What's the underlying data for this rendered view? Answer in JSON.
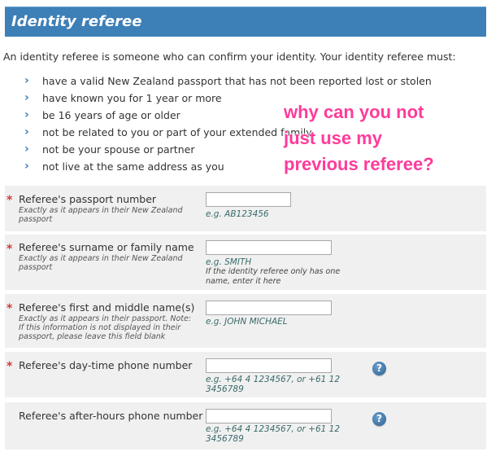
{
  "header": {
    "title": "Identity referee"
  },
  "intro": "An identity referee is someone who can confirm your identity. Your identity referee must:",
  "requirements": [
    "have a valid New Zealand passport that has not been reported lost or stolen",
    "have known you for 1 year or more",
    "be 16 years of age or older",
    "not be related to you or part of your extended family",
    "not be your spouse or partner",
    "not live at the same address as you"
  ],
  "annotation": {
    "line1": "why can you not",
    "line2": "just use my",
    "line3": "previous referee?"
  },
  "fields": {
    "passport": {
      "required": "*",
      "label": "Referee's passport number",
      "help": "Exactly as it appears in their New Zealand passport",
      "example": "e.g. AB123456",
      "value": ""
    },
    "surname": {
      "required": "*",
      "label": "Referee's surname or family name",
      "help": "Exactly as it appears in their New Zealand passport",
      "example": "e.g. SMITH",
      "note": "If the identity referee only has one name, enter it here",
      "value": ""
    },
    "firstname": {
      "required": "*",
      "label": "Referee's first and middle name(s)",
      "help": "Exactly as it appears in their passport. Note: If this information is not displayed in their passport, please leave this field blank",
      "example": "e.g. JOHN MICHAEL",
      "value": ""
    },
    "dayphone": {
      "required": "*",
      "label": "Referee's day-time phone number",
      "example": "e.g. +64 4 1234567, or +61 12 3456789",
      "help_icon": "?",
      "value": ""
    },
    "afterphone": {
      "label": "Referee's after-hours phone number",
      "example": "e.g. +64 4 1234567, or +61 12 3456789",
      "help_icon": "?",
      "value": ""
    }
  }
}
